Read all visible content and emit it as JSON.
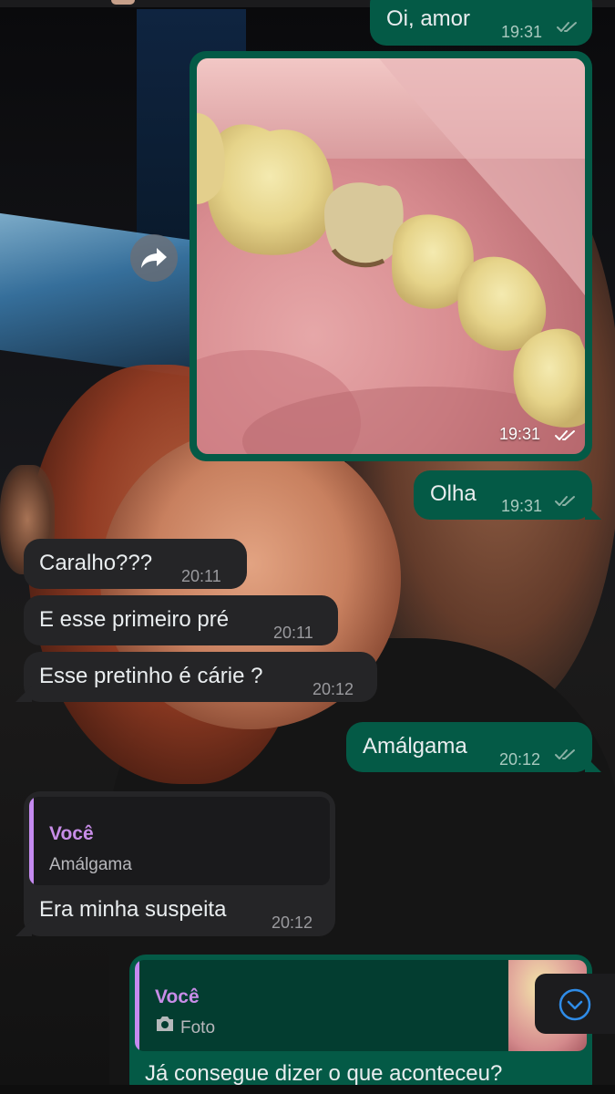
{
  "messages": [
    {
      "id": "m1",
      "text": "Oi, amor",
      "time": "19:31"
    },
    {
      "id": "m2",
      "type": "photo",
      "time": "19:31"
    },
    {
      "id": "m3",
      "text": "Olha",
      "time": "19:31"
    },
    {
      "id": "m4",
      "text": "Caralho???",
      "time": "20:11"
    },
    {
      "id": "m5",
      "text": "E esse primeiro pré",
      "time": "20:11"
    },
    {
      "id": "m6",
      "text": "Esse pretinho é cárie ?",
      "time": "20:12"
    },
    {
      "id": "m7",
      "text": "Amálgama",
      "time": "20:12"
    },
    {
      "id": "m8",
      "quote_name": "Você",
      "quote_text": "Amálgama",
      "text": "Era minha suspeita",
      "time": "20:12"
    },
    {
      "id": "m9",
      "quote_name": "Você",
      "quote_text": "Foto",
      "text": "Já consegue dizer o que aconteceu?"
    }
  ],
  "icons": {
    "read_receipt": "double-check-icon",
    "forward": "forward-icon",
    "camera": "camera-icon",
    "scroll_down": "chevron-down-icon"
  },
  "colors": {
    "outgoing_bubble": "#045a46",
    "incoming_bubble": "#252527",
    "quote_accent": "#c58af0",
    "read_tick": "#8ab0a4",
    "scroll_icon": "#2f8ce8"
  }
}
